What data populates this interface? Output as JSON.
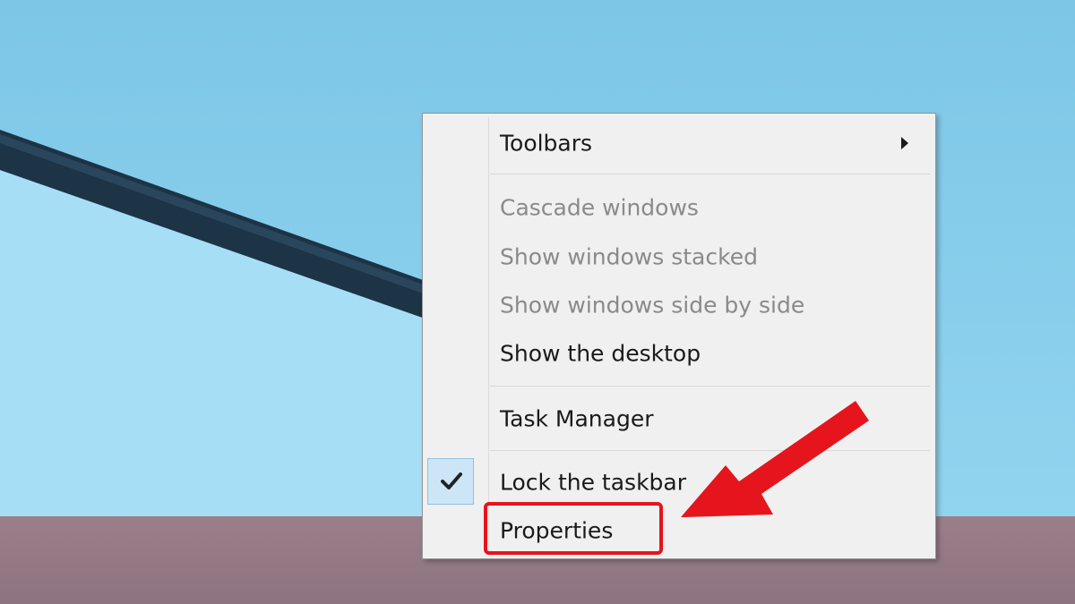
{
  "context_menu": {
    "items": [
      {
        "label": "Toolbars",
        "state": "enabled",
        "submenu": true
      },
      {
        "label": "Cascade windows",
        "state": "disabled"
      },
      {
        "label": "Show windows stacked",
        "state": "disabled"
      },
      {
        "label": "Show windows side by side",
        "state": "disabled"
      },
      {
        "label": "Show the desktop",
        "state": "enabled"
      },
      {
        "label": "Task Manager",
        "state": "enabled"
      },
      {
        "label": "Lock the taskbar",
        "state": "enabled",
        "checked": true
      },
      {
        "label": "Properties",
        "state": "enabled",
        "highlighted": true
      }
    ]
  },
  "icons": {
    "submenu": "chevron-right-icon",
    "check": "check-icon"
  },
  "colors": {
    "annotation_red": "#e6141c",
    "menu_background": "#f0f0f0",
    "disabled_text": "#8a8a8a",
    "taskbar": "#9a7f89",
    "desktop_sky": "#7ec6e6"
  }
}
